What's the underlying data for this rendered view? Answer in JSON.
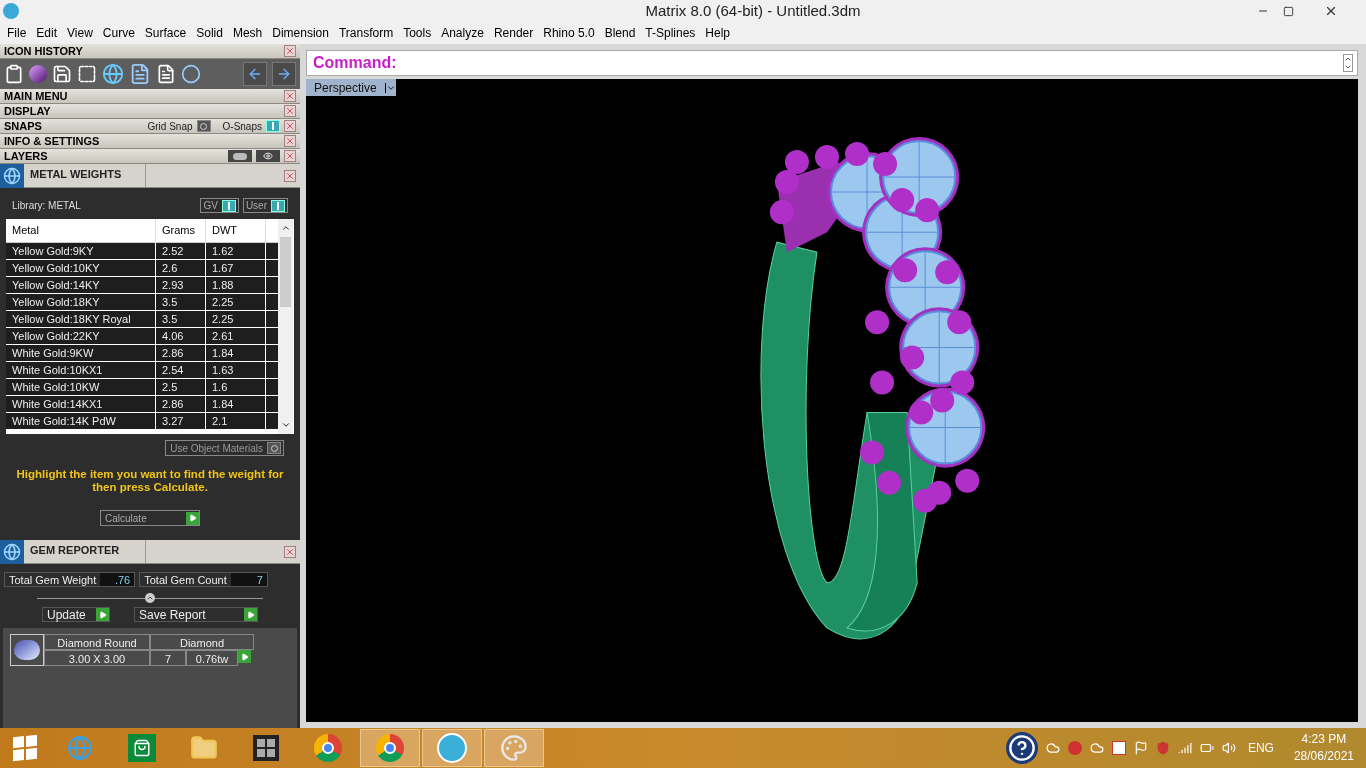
{
  "window": {
    "title": "Matrix 8.0 (64-bit) - Untitled.3dm"
  },
  "menu": [
    "File",
    "Edit",
    "View",
    "Curve",
    "Surface",
    "Solid",
    "Mesh",
    "Dimension",
    "Transform",
    "Tools",
    "Analyze",
    "Render",
    "Rhino 5.0",
    "Blend",
    "T-Splines",
    "Help"
  ],
  "icon_history": {
    "title": "ICON HISTORY"
  },
  "sections": [
    {
      "title": "MAIN MENU",
      "kind": "plain"
    },
    {
      "title": "DISPLAY",
      "kind": "plain"
    },
    {
      "title": "SNAPS",
      "kind": "snaps",
      "toggles": [
        {
          "label": "Grid Snap",
          "on": false
        },
        {
          "label": "O-Snaps",
          "on": true
        }
      ]
    },
    {
      "title": "INFO & SETTINGS",
      "kind": "plain"
    },
    {
      "title": "LAYERS",
      "kind": "layers"
    }
  ],
  "metal_weights": {
    "title": "METAL WEIGHTS",
    "library": "Library: METAL",
    "toggles": [
      {
        "label": "GV",
        "on": true
      },
      {
        "label": "User",
        "on": true
      }
    ],
    "columns": [
      "Metal",
      "Grams",
      "DWT"
    ],
    "rows": [
      [
        "Yellow Gold:9KY",
        "2.52",
        "1.62"
      ],
      [
        "Yellow Gold:10KY",
        "2.6",
        "1.67"
      ],
      [
        "Yellow Gold:14KY",
        "2.93",
        "1.88"
      ],
      [
        "Yellow Gold:18KY",
        "3.5",
        "2.25"
      ],
      [
        "Yellow Gold:18KY Royal",
        "3.5",
        "2.25"
      ],
      [
        "Yellow Gold:22KY",
        "4.06",
        "2.61"
      ],
      [
        "White Gold:9KW",
        "2.86",
        "1.84"
      ],
      [
        "White Gold:10KX1",
        "2.54",
        "1.63"
      ],
      [
        "White Gold:10KW",
        "2.5",
        "1.6"
      ],
      [
        "White Gold:14KX1",
        "2.86",
        "1.84"
      ],
      [
        "White Gold:14K PdW",
        "3.27",
        "2.1"
      ]
    ],
    "use_object_materials": {
      "label": "Use Object Materials",
      "on": false
    },
    "hint": "Highlight the item you want to find the weight for then press Calculate.",
    "calculate": "Calculate"
  },
  "gem_reporter": {
    "title": "GEM REPORTER",
    "stats": [
      {
        "label": "Total Gem Weight",
        "value": ".76"
      },
      {
        "label": "Total Gem Count",
        "value": "7"
      }
    ],
    "buttons": [
      "Update",
      "Save Report"
    ],
    "gem": {
      "shape": "Diamond Round",
      "size": "3.00 X 3.00",
      "material": "Diamond",
      "count": "7",
      "weight": "0.76tw"
    }
  },
  "command": {
    "label": "Command:"
  },
  "viewport": {
    "name": "Perspective"
  },
  "taskbar": {
    "apps": [
      {
        "kind": "ie",
        "active": false
      },
      {
        "kind": "store",
        "active": false
      },
      {
        "kind": "explorer",
        "active": false
      },
      {
        "kind": "matrix",
        "active": false
      },
      {
        "kind": "chrome",
        "active": false
      },
      {
        "kind": "chrome",
        "active": true
      },
      {
        "kind": "v8",
        "active": true
      },
      {
        "kind": "paint",
        "active": true
      }
    ],
    "language": "ENG",
    "time": "4:23 PM",
    "date": "28/06/2021"
  }
}
